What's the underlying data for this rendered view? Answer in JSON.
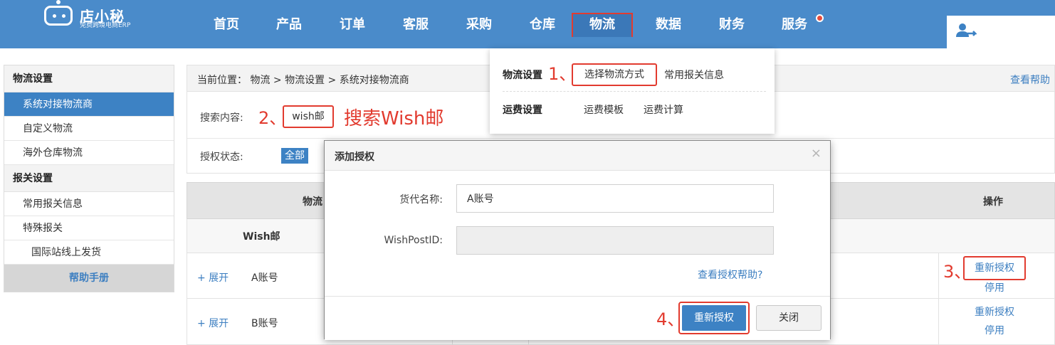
{
  "logo": {
    "title": "店小秘",
    "subtitle": "免费跨境电商ERP"
  },
  "nav": {
    "items": [
      {
        "label": "首页"
      },
      {
        "label": "产品"
      },
      {
        "label": "订单"
      },
      {
        "label": "客服"
      },
      {
        "label": "采购"
      },
      {
        "label": "仓库"
      },
      {
        "label": "物流"
      },
      {
        "label": "数据"
      },
      {
        "label": "财务"
      },
      {
        "label": "服务"
      }
    ],
    "active": "物流"
  },
  "sidebar": {
    "sections": [
      {
        "title": "物流设置"
      },
      {
        "title": "报关设置"
      }
    ],
    "items": [
      {
        "label": "系统对接物流商"
      },
      {
        "label": "自定义物流"
      },
      {
        "label": "海外仓库物流"
      },
      {
        "label": "常用报关信息"
      },
      {
        "label": "特殊报关"
      },
      {
        "label": "国际站线上发货"
      }
    ],
    "help": "帮助手册"
  },
  "breadcrumb": {
    "text": "当前位置：  物流 >  物流设置 > 系统对接物流商",
    "help": "查看帮助"
  },
  "filter": {
    "search_label": "搜索内容:",
    "search_value": "wish邮",
    "status_label": "授权状态:",
    "status_all": "全部"
  },
  "annotations": {
    "step1": "1、",
    "step2": "2、",
    "step3": "3、",
    "step4": "4、",
    "search_hint": "搜索Wish邮"
  },
  "table": {
    "col_logistics": "物流",
    "col_ops": "操作",
    "group": "Wish邮",
    "rows": [
      {
        "expand": "+ 展开",
        "account": "A账号",
        "op1": "重新授权",
        "op2": "停用"
      },
      {
        "expand": "+ 展开",
        "account": "B账号",
        "op1": "重新授权",
        "op2": "停用"
      }
    ]
  },
  "dropdown": {
    "sec1": "物流设置",
    "sec1_items": [
      "选择物流方式",
      "常用报关信息"
    ],
    "sec2": "运费设置",
    "sec2_items": [
      "运费模板",
      "运费计算"
    ]
  },
  "modal": {
    "title": "添加授权",
    "close": "×",
    "field1_label": "货代名称:",
    "field1_value": "A账号",
    "field2_label": "WishPostID:",
    "field2_value": "",
    "help_link": "查看授权帮助?",
    "btn_reauth": "重新授权",
    "btn_close": "关闭"
  },
  "colors": {
    "brand": "#4a8bca",
    "accent": "#3d82c4",
    "highlight": "#e23b2f"
  }
}
